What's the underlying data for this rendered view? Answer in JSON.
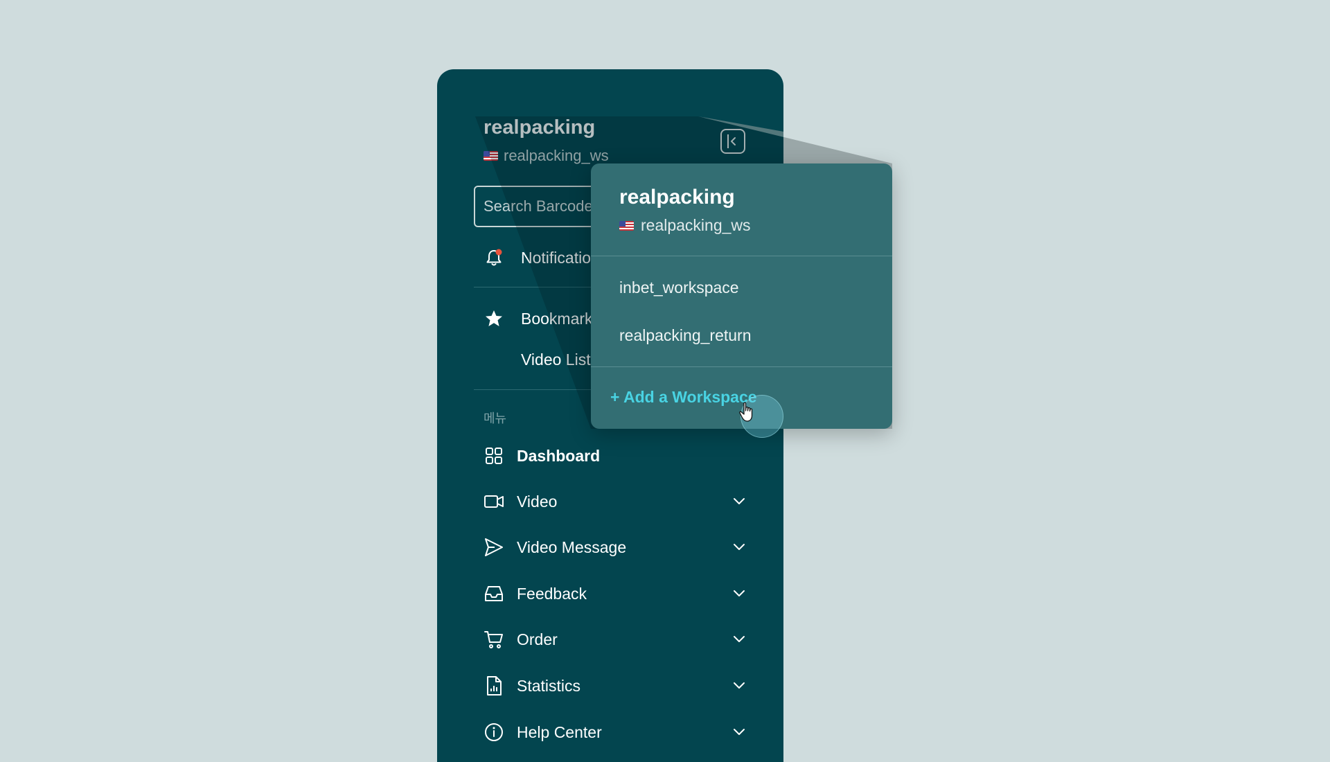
{
  "workspace": {
    "name": "realpacking",
    "sub": "realpacking_ws"
  },
  "search": {
    "placeholder": "Search Barcode"
  },
  "notifications": {
    "label": "Notifications"
  },
  "bookmarks": {
    "label": "Bookmarks",
    "items": [
      "Video List"
    ]
  },
  "menu_section_label": "메뉴",
  "menu": [
    {
      "label": "Dashboard",
      "icon": "grid-icon",
      "expandable": false
    },
    {
      "label": "Video",
      "icon": "video-camera-icon",
      "expandable": true
    },
    {
      "label": "Video Message",
      "icon": "send-icon",
      "expandable": true
    },
    {
      "label": "Feedback",
      "icon": "inbox-icon",
      "expandable": true
    },
    {
      "label": "Order",
      "icon": "cart-icon",
      "expandable": true
    },
    {
      "label": "Statistics",
      "icon": "report-icon",
      "expandable": true
    },
    {
      "label": "Help Center",
      "icon": "info-icon",
      "expandable": true
    }
  ],
  "dropdown": {
    "current_name": "realpacking",
    "current_sub": "realpacking_ws",
    "workspaces": [
      "inbet_workspace",
      "realpacking_return"
    ],
    "add_label": "+ Add a Workspace"
  },
  "colors": {
    "sidebar_bg": "#03454f",
    "dropdown_bg": "#336e73",
    "accent": "#49d3e3",
    "page_bg": "#cfdcdd"
  }
}
